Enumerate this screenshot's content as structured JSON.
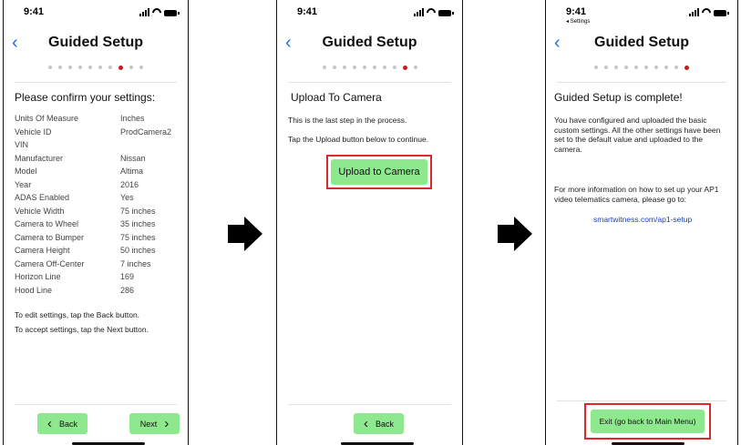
{
  "status": {
    "time": "9:41",
    "back_label": "◂ Settings"
  },
  "nav": {
    "title": "Guided Setup",
    "back_chevron": "‹"
  },
  "screen1": {
    "heading": "Please confirm your settings:",
    "dots_total": 10,
    "active_dot": 8,
    "settings": [
      {
        "label": "Units Of Measure",
        "value": "Inches"
      },
      {
        "label": "Vehicle ID",
        "value": "ProdCamera2"
      },
      {
        "label": "VIN",
        "value": ""
      },
      {
        "label": "Manufacturer",
        "value": "Nissan"
      },
      {
        "label": "Model",
        "value": "Altima"
      },
      {
        "label": "Year",
        "value": "2016"
      },
      {
        "label": "ADAS Enabled",
        "value": "Yes"
      },
      {
        "label": "Vehicle Width",
        "value": "75 inches"
      },
      {
        "label": "Camera to Wheel",
        "value": "35 inches"
      },
      {
        "label": "Camera to Bumper",
        "value": "75 inches"
      },
      {
        "label": "Camera Height",
        "value": "50 inches"
      },
      {
        "label": "Camera Off-Center",
        "value": "7 inches"
      },
      {
        "label": "Horizon Line",
        "value": "169"
      },
      {
        "label": "Hood Line",
        "value": "286"
      }
    ],
    "note_edit": "To edit settings, tap the Back button.",
    "note_accept": "To accept settings, tap the Next button.",
    "back_label": "Back",
    "next_label": "Next"
  },
  "screen2": {
    "heading": "Upload To Camera",
    "line1": "This is the last step in the process.",
    "line2": "Tap the Upload button below to continue.",
    "upload_label": "Upload to Camera",
    "back_label": "Back",
    "dots_total": 10,
    "active_dot": 9
  },
  "screen3": {
    "heading": "Guided Setup is complete!",
    "para1": "You have configured and uploaded the basic custom settings. All the other settings have been set to the default value and uploaded to the camera.",
    "para2": "For more information on how to set up your AP1 video telematics camera, please go to:",
    "link": "smartwitness.com/ap1-setup",
    "exit_label": "Exit (go back to Main Menu)",
    "dots_total": 10,
    "active_dot": 10
  },
  "colors": {
    "accent": "#1a73e8",
    "button": "#8ee88e",
    "highlight": "#d92b2b",
    "active_dot": "#c91a1a"
  },
  "icons": {
    "arrow_between": "right-arrow-icon",
    "back": "chevron-left-icon",
    "next": "chevron-right-icon"
  }
}
